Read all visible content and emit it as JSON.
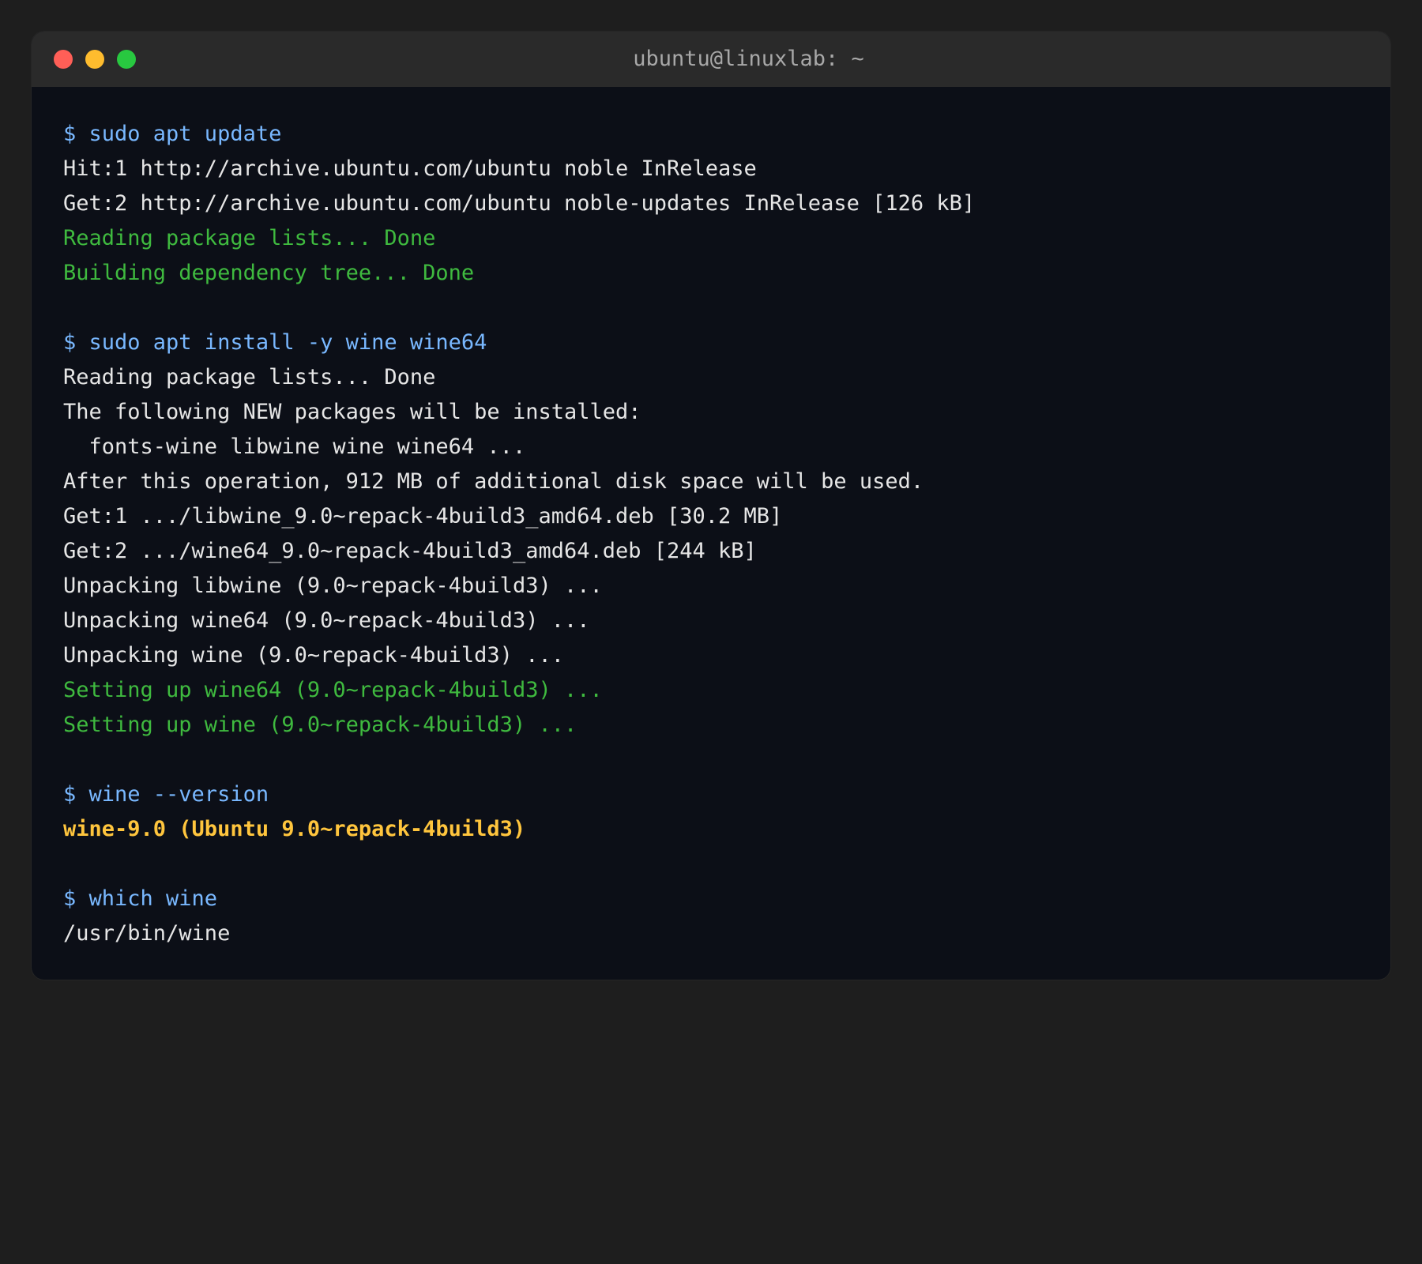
{
  "window": {
    "title": "ubuntu@linuxlab: ~",
    "buttons": [
      {
        "name": "close",
        "color": "#ff5f57"
      },
      {
        "name": "minimize",
        "color": "#febc2e"
      },
      {
        "name": "maximize",
        "color": "#28c840"
      }
    ]
  },
  "colors": {
    "background": "#1e1e1e",
    "terminal_bg": "#0c0f17",
    "title_bar": "#2a2a2a",
    "command": "#79b8ff",
    "output": "#e6e6e6",
    "success": "#3fba3f",
    "highlight": "#ffc53d"
  },
  "terminal": {
    "lines": [
      {
        "type": "command",
        "text": "$ sudo apt update"
      },
      {
        "type": "output",
        "text": "Hit:1 http://archive.ubuntu.com/ubuntu noble InRelease"
      },
      {
        "type": "output",
        "text": "Get:2 http://archive.ubuntu.com/ubuntu noble-updates InRelease [126 kB]"
      },
      {
        "type": "success",
        "text": "Reading package lists... Done"
      },
      {
        "type": "success",
        "text": "Building dependency tree... Done"
      },
      {
        "type": "blank",
        "text": ""
      },
      {
        "type": "command",
        "text": "$ sudo apt install -y wine wine64"
      },
      {
        "type": "output",
        "text": "Reading package lists... Done"
      },
      {
        "type": "output",
        "text": "The following NEW packages will be installed:"
      },
      {
        "type": "output",
        "text": "  fonts-wine libwine wine wine64 ..."
      },
      {
        "type": "output",
        "text": "After this operation, 912 MB of additional disk space will be used."
      },
      {
        "type": "output",
        "text": "Get:1 .../libwine_9.0~repack-4build3_amd64.deb [30.2 MB]"
      },
      {
        "type": "output",
        "text": "Get:2 .../wine64_9.0~repack-4build3_amd64.deb [244 kB]"
      },
      {
        "type": "output",
        "text": "Unpacking libwine (9.0~repack-4build3) ..."
      },
      {
        "type": "output",
        "text": "Unpacking wine64 (9.0~repack-4build3) ..."
      },
      {
        "type": "output",
        "text": "Unpacking wine (9.0~repack-4build3) ..."
      },
      {
        "type": "success",
        "text": "Setting up wine64 (9.0~repack-4build3) ..."
      },
      {
        "type": "success",
        "text": "Setting up wine (9.0~repack-4build3) ..."
      },
      {
        "type": "blank",
        "text": ""
      },
      {
        "type": "command",
        "text": "$ wine --version"
      },
      {
        "type": "highlight",
        "text": "wine-9.0 (Ubuntu 9.0~repack-4build3)"
      },
      {
        "type": "blank",
        "text": ""
      },
      {
        "type": "command",
        "text": "$ which wine"
      },
      {
        "type": "output",
        "text": "/usr/bin/wine"
      }
    ]
  }
}
